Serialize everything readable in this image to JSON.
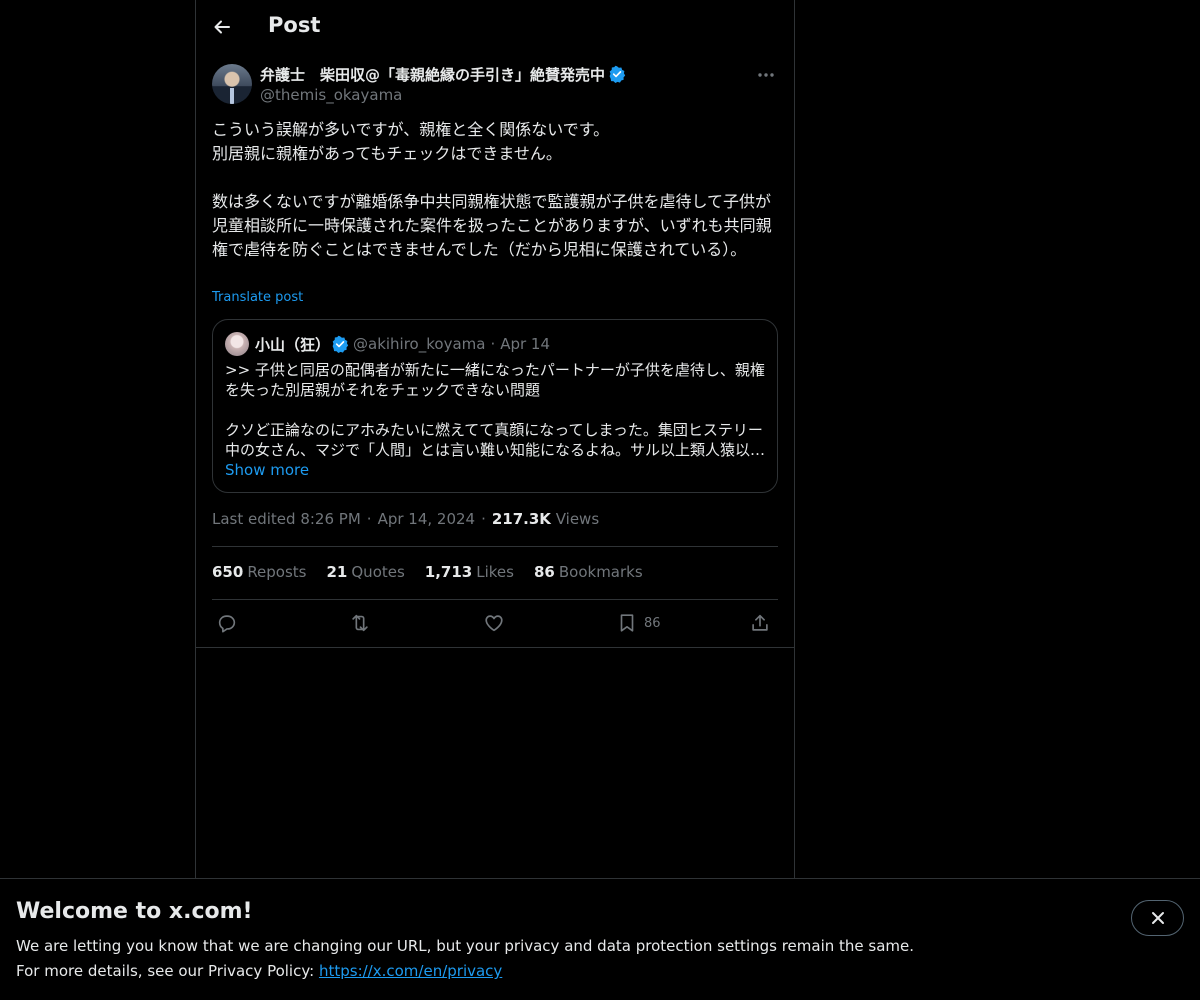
{
  "header": {
    "title": "Post"
  },
  "post": {
    "author": {
      "display_name": "弁護士　柴田収@「毒親絶縁の手引き」絶賛発売中",
      "handle": "@themis_okayama"
    },
    "text": "こういう誤解が多いですが、親権と全く関係ないです。\n別居親に親権があってもチェックはできません。\n\n数は多くないですが離婚係争中共同親権状態で監護親が子供を虐待して子供が児童相談所に一時保護された案件を扱ったことがありますが、いずれも共同親権で虐待を防ぐことはできませんでした（だから児相に保護されている）。",
    "translate_label": "Translate post",
    "quote": {
      "display_name": "小山（狂）",
      "handle": "@akihiro_koyama",
      "date": "Apr 14",
      "text": ">> 子供と同居の配偶者が新たに一緒になったパートナーが子供を虐待し、親権を失った別居親がそれをチェックできない問題\n\nクソど正論なのにアホみたいに燃えてて真顔になってしまった。集団ヒステリー中の女さん、マジで「人間」とは言い難い知能になるよね。サル以上類人猿以…",
      "show_more_label": "Show more"
    },
    "edited_label": "Last edited 8:26 PM",
    "date": "Apr 14, 2024",
    "views_count": "217.3K",
    "views_label": "Views",
    "stats": {
      "reposts_count": "650",
      "reposts_label": "Reposts",
      "quotes_count": "21",
      "quotes_label": "Quotes",
      "likes_count": "1,713",
      "likes_label": "Likes",
      "bookmarks_count": "86",
      "bookmarks_label": "Bookmarks"
    },
    "actions": {
      "bookmark_count": "86"
    }
  },
  "banner": {
    "title": "Welcome to x.com!",
    "line1": "We are letting you know that we are changing our URL, but your privacy and data protection settings remain the same.",
    "line2_prefix": "For more details, see our Privacy Policy:",
    "link": "https://x.com/en/privacy"
  },
  "colors": {
    "background": "#000000",
    "text": "#e7e9ea",
    "secondary": "#71767b",
    "accent": "#1d9bf0",
    "border": "#2f3336"
  },
  "icons": {
    "back": "arrow-left-icon",
    "more": "more-horizontal-icon",
    "verified": "verified-badge-icon",
    "reply": "reply-icon",
    "repost": "repost-icon",
    "like": "heart-icon",
    "bookmark": "bookmark-icon",
    "share": "share-icon",
    "close": "close-icon"
  }
}
